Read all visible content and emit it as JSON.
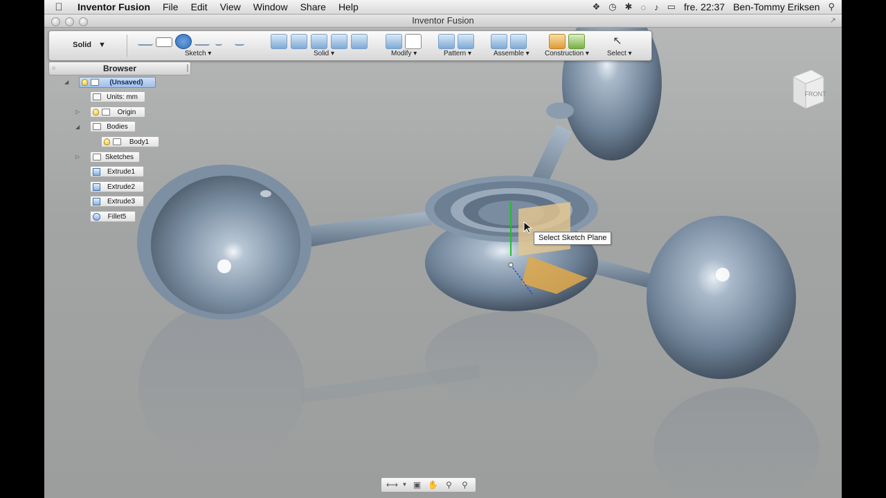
{
  "menubar": {
    "app_name": "Inventor Fusion",
    "menus": [
      "File",
      "Edit",
      "View",
      "Window",
      "Share",
      "Help"
    ],
    "clock": "fre. 22:37",
    "user": "Ben-Tommy Eriksen"
  },
  "window": {
    "title": "Inventor Fusion"
  },
  "toolbar": {
    "mode": "Solid",
    "groups": [
      {
        "label": "Sketch"
      },
      {
        "label": "Solid"
      },
      {
        "label": "Modify"
      },
      {
        "label": "Pattern"
      },
      {
        "label": "Assemble"
      },
      {
        "label": "Construction"
      },
      {
        "label": "Select"
      }
    ]
  },
  "browser": {
    "title": "Browser",
    "root": "(Unsaved)",
    "units": "Units: mm",
    "origin": "Origin",
    "bodies": "Bodies",
    "body1": "Body1",
    "sketches": "Sketches",
    "extrude1": "Extrude1",
    "extrude2": "Extrude2",
    "extrude3": "Extrude3",
    "fillet5": "Fillet5"
  },
  "viewcube": {
    "face": "FRONT"
  },
  "tooltip": {
    "text": "Select Sketch Plane"
  },
  "colors": {
    "model": "#7f93a8",
    "sketch_plane": "#e0b36a",
    "viewport_bg": "#a9abab"
  }
}
